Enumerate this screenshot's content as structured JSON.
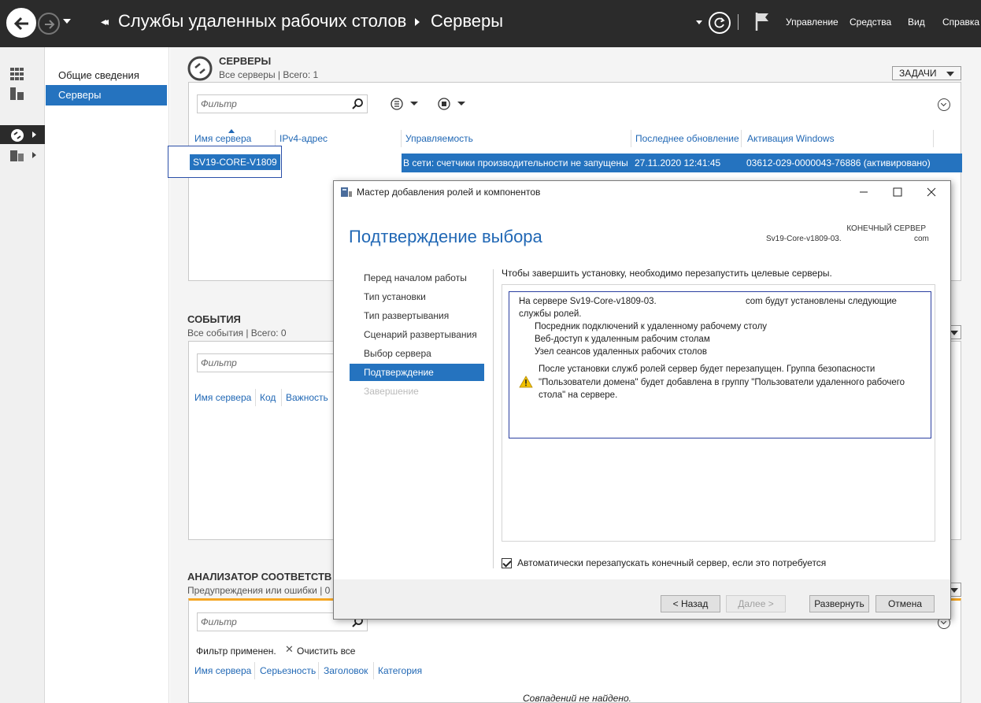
{
  "titlebar": {
    "root": "Службы удаленных рабочих столов",
    "current": "Серверы",
    "menu": [
      "Управление",
      "Средства",
      "Вид",
      "Справка"
    ]
  },
  "nav": {
    "items": [
      "Общие сведения",
      "Серверы"
    ]
  },
  "servers": {
    "title": "СЕРВЕРЫ",
    "subtitle": "Все серверы | Всего: 1",
    "tasks": "ЗАДАЧИ",
    "filter": "Фильтр",
    "columns": [
      "Имя сервера",
      "IPv4-адрес",
      "Управляемость",
      "Последнее обновление",
      "Активация Windows"
    ],
    "row": {
      "name": "SV19-CORE-V1809",
      "manageability": "В сети: счетчики производительности не запущены",
      "last_update": "27.11.2020 12:41:45",
      "activation": "03612-029-0000043-76886 (активировано)"
    }
  },
  "events": {
    "title": "СОБЫТИЯ",
    "subtitle": "Все события | Всего: 0",
    "filter": "Фильтр",
    "columns": [
      "Имя сервера",
      "Код",
      "Важность"
    ]
  },
  "bpa": {
    "title": "АНАЛИЗАТОР СООТВЕТСТВ",
    "subtitle": "Предупреждения или ошибки | 0",
    "filter": "Фильтр",
    "filter_applied": "Фильтр применен.",
    "clear_all": "Очистить все",
    "columns": [
      "Имя сервера",
      "Серьезность",
      "Заголовок",
      "Категория"
    ],
    "no_matches": "Совпадений не найдено."
  },
  "dialog": {
    "title": "Мастер добавления ролей и компонентов",
    "heading": "Подтверждение выбора",
    "dest_label": "КОНЕЧНЫЙ СЕРВЕР",
    "dest_name": "Sv19-Core-v1809-03.",
    "dest_suffix": "com",
    "steps": [
      {
        "label": "Перед началом работы",
        "state": "normal"
      },
      {
        "label": "Тип установки",
        "state": "normal"
      },
      {
        "label": "Тип развертывания",
        "state": "normal"
      },
      {
        "label": "Сценарий развертывания",
        "state": "normal"
      },
      {
        "label": "Выбор сервера",
        "state": "normal"
      },
      {
        "label": "Подтверждение",
        "state": "current"
      },
      {
        "label": "Завершение",
        "state": "disabled"
      }
    ],
    "restart_note": "Чтобы завершить установку, необходимо перезапустить целевые серверы.",
    "summary_line1": "На сервере Sv19-Core-v1809-03.",
    "summary_line1_suffix": "com будут установлены следующие",
    "summary_line2": "службы ролей.",
    "roles": [
      "Посредник подключений к удаленному рабочему столу",
      "Веб-доступ к удаленным рабочим столам",
      "Узел сеансов удаленных рабочих столов"
    ],
    "warning": "После установки служб ролей сервер будет перезапущен. Группа безопасности \"Пользователи домена\" будет добавлена в группу \"Пользователи удаленного рабочего стола\" на сервере.",
    "auto_restart": "Автоматически перезапускать конечный сервер, если это потребуется",
    "buttons": {
      "back": "< Назад",
      "next": "Далее >",
      "deploy": "Развернуть",
      "cancel": "Отмена"
    }
  }
}
